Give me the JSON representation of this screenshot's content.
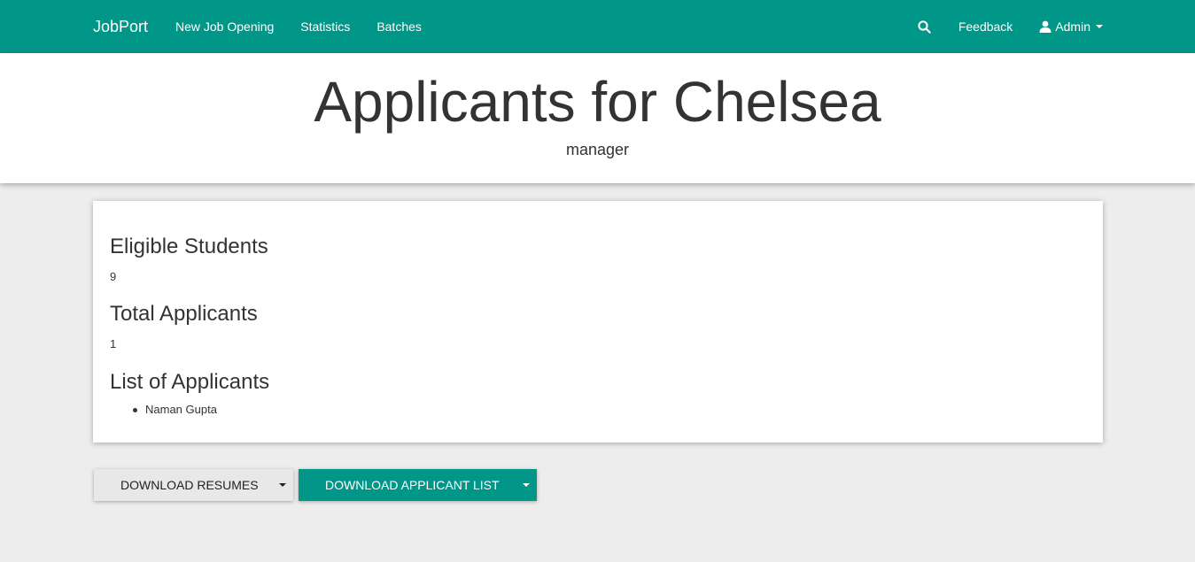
{
  "colors": {
    "accent": "#009688",
    "background": "#ededed"
  },
  "navbar": {
    "brand": "JobPort",
    "links": [
      "New Job Opening",
      "Statistics",
      "Batches"
    ],
    "search_icon": "search-icon",
    "feedback": "Feedback",
    "user_icon": "user-icon",
    "admin": "Admin"
  },
  "header": {
    "title": "Applicants for Chelsea",
    "subtitle": "manager"
  },
  "card": {
    "eligible_heading": "Eligible Students",
    "eligible_value": "9",
    "total_heading": "Total Applicants",
    "total_value": "1",
    "list_heading": "List of Applicants",
    "applicants": [
      "Naman Gupta"
    ]
  },
  "actions": {
    "download_resumes": "DOWNLOAD RESUMES",
    "download_list": "DOWNLOAD APPLICANT LIST"
  }
}
